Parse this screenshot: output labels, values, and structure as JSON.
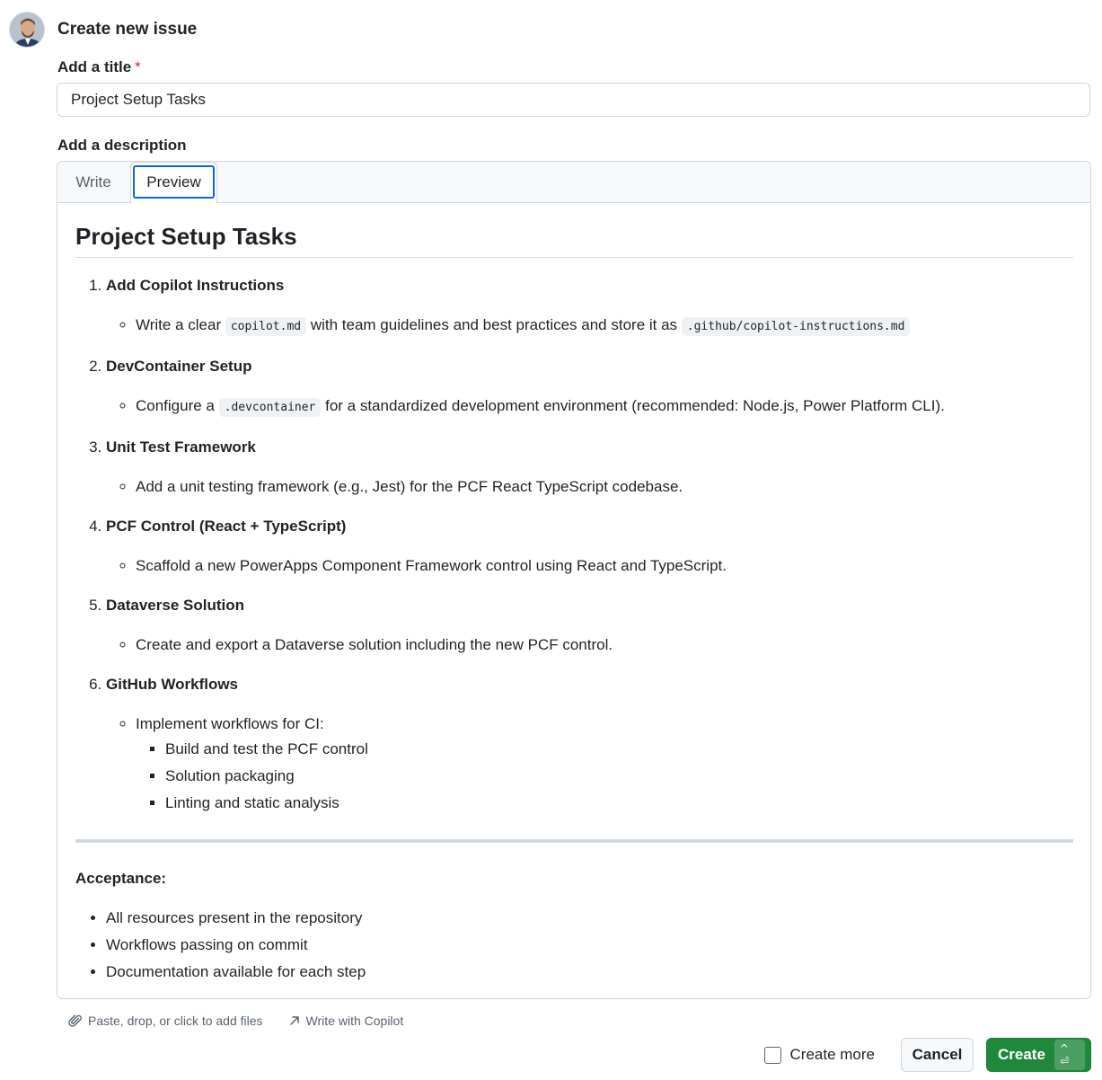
{
  "header": {
    "title": "Create new issue"
  },
  "title_field": {
    "label": "Add a title",
    "required_mark": "*",
    "value": "Project Setup Tasks"
  },
  "description": {
    "label": "Add a description",
    "tabs": [
      {
        "label": "Write"
      },
      {
        "label": "Preview"
      }
    ],
    "active_tab": "Preview"
  },
  "preview": {
    "heading": "Project Setup Tasks",
    "tasks": [
      {
        "num": "1.",
        "title": "Add Copilot Instructions",
        "text_a": "Write a clear ",
        "code_a": "copilot.md",
        "text_b": " with team guidelines and best practices and store it as ",
        "code_b": ".github/copilot-instructions.md"
      },
      {
        "num": "2.",
        "title": "DevContainer Setup",
        "text_a": "Configure a ",
        "code_a": ".devcontainer",
        "text_b": " for a standardized development environment (recommended: Node.js, Power Platform CLI)."
      },
      {
        "num": "3.",
        "title": "Unit Test Framework",
        "text": "Add a unit testing framework (e.g., Jest) for the PCF React TypeScript codebase."
      },
      {
        "num": "4.",
        "title": "PCF Control (React + TypeScript)",
        "text": "Scaffold a new PowerApps Component Framework control using React and TypeScript."
      },
      {
        "num": "5.",
        "title": "Dataverse Solution",
        "text": "Create and export a Dataverse solution including the new PCF control."
      },
      {
        "num": "6.",
        "title": "GitHub Workflows",
        "text": "Implement workflows for CI:",
        "items": [
          "Build and test the PCF control",
          "Solution packaging",
          "Linting and static analysis"
        ]
      }
    ],
    "acceptance_title": "Acceptance:",
    "acceptance_items": [
      "All resources present in the repository",
      "Workflows passing on commit",
      "Documentation available for each step"
    ]
  },
  "footer": {
    "attach_label": "Paste, drop, or click to add files",
    "copilot_label": "Write with Copilot",
    "create_more_label": "Create more",
    "cancel_label": "Cancel",
    "create_label": "Create",
    "create_shortcut": "^ ⏎"
  },
  "colors": {
    "primary_green": "#1f883d",
    "focus_blue": "#0969da",
    "required_red": "#d1242f"
  }
}
